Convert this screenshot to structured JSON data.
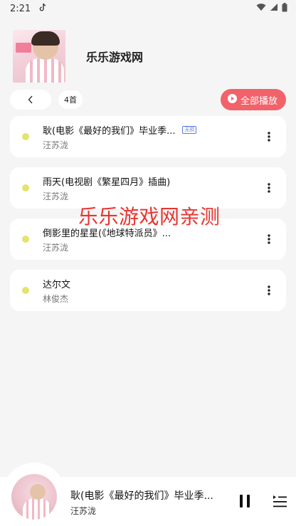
{
  "status_bar": {
    "time": "2:21",
    "notification_icon": "tiktok-icon"
  },
  "header": {
    "playlist_title": "乐乐游戏网"
  },
  "toolbar": {
    "count_label": "4首",
    "play_all_label": "全部播放"
  },
  "songs": [
    {
      "title": "耿(电影《最好的我们》毕业季...",
      "artist": "汪苏泷",
      "badge": "无损"
    },
    {
      "title": "雨天(电视剧《繁星四月》插曲)",
      "artist": "汪苏泷"
    },
    {
      "title": "倒影里的星星(《地球特派员》...",
      "artist": "汪苏泷"
    },
    {
      "title": "达尔文",
      "artist": "林俊杰"
    }
  ],
  "watermark": "乐乐游戏网亲测",
  "player": {
    "title": "耿(电影《最好的我们》毕业季...",
    "artist": "汪苏泷"
  },
  "colors": {
    "accent": "#f2626a",
    "dot": "#e4e36e",
    "watermark": "#e8352f"
  }
}
